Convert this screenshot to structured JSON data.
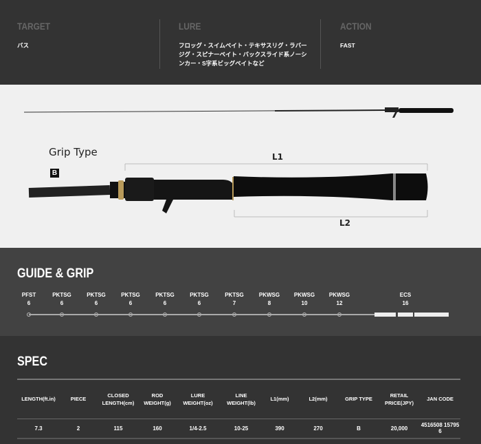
{
  "info": {
    "target": {
      "label": "TARGET",
      "value": "バス"
    },
    "lure": {
      "label": "LURE",
      "value": "フロッグ・スイムベイト・テキサスリグ・ラバージグ・スピナーベイト・バックスライド系ノーシンカー・S字系ビッグベイトなど"
    },
    "action": {
      "label": "ACTION",
      "value": "FAST"
    }
  },
  "grip": {
    "title": "Grip Type",
    "type": "B",
    "l1": "L1",
    "l2": "L2"
  },
  "guide": {
    "title": "GUIDE & GRIP",
    "guides": [
      {
        "name": "PFST",
        "size": "6"
      },
      {
        "name": "PKTSG",
        "size": "6"
      },
      {
        "name": "PKTSG",
        "size": "6"
      },
      {
        "name": "PKTSG",
        "size": "6"
      },
      {
        "name": "PKTSG",
        "size": "6"
      },
      {
        "name": "PKTSG",
        "size": "6"
      },
      {
        "name": "PKTSG",
        "size": "7"
      },
      {
        "name": "PKWSG",
        "size": "8"
      },
      {
        "name": "PKWSG",
        "size": "10"
      },
      {
        "name": "PKWSG",
        "size": "12"
      }
    ],
    "seat": {
      "name": "ECS",
      "size": "16"
    }
  },
  "spec": {
    "title": "SPEC",
    "headers": [
      "LENGTH(ft.in)",
      "PIECE",
      "CLOSED\nLENGTH(cm)",
      "ROD\nWEIGHT(g)",
      "LURE\nWEIGHT(oz)",
      "LINE\nWEIGHT(lb)",
      "L1(mm)",
      "L2(mm)",
      "GRIP TYPE",
      "RETAIL\nPRICE(JPY)",
      "JAN CODE"
    ],
    "row": [
      "7.3",
      "2",
      "115",
      "160",
      "1/4-2.5",
      "10-25",
      "390",
      "270",
      "B",
      "20,000",
      "4516508 15795 6"
    ]
  }
}
